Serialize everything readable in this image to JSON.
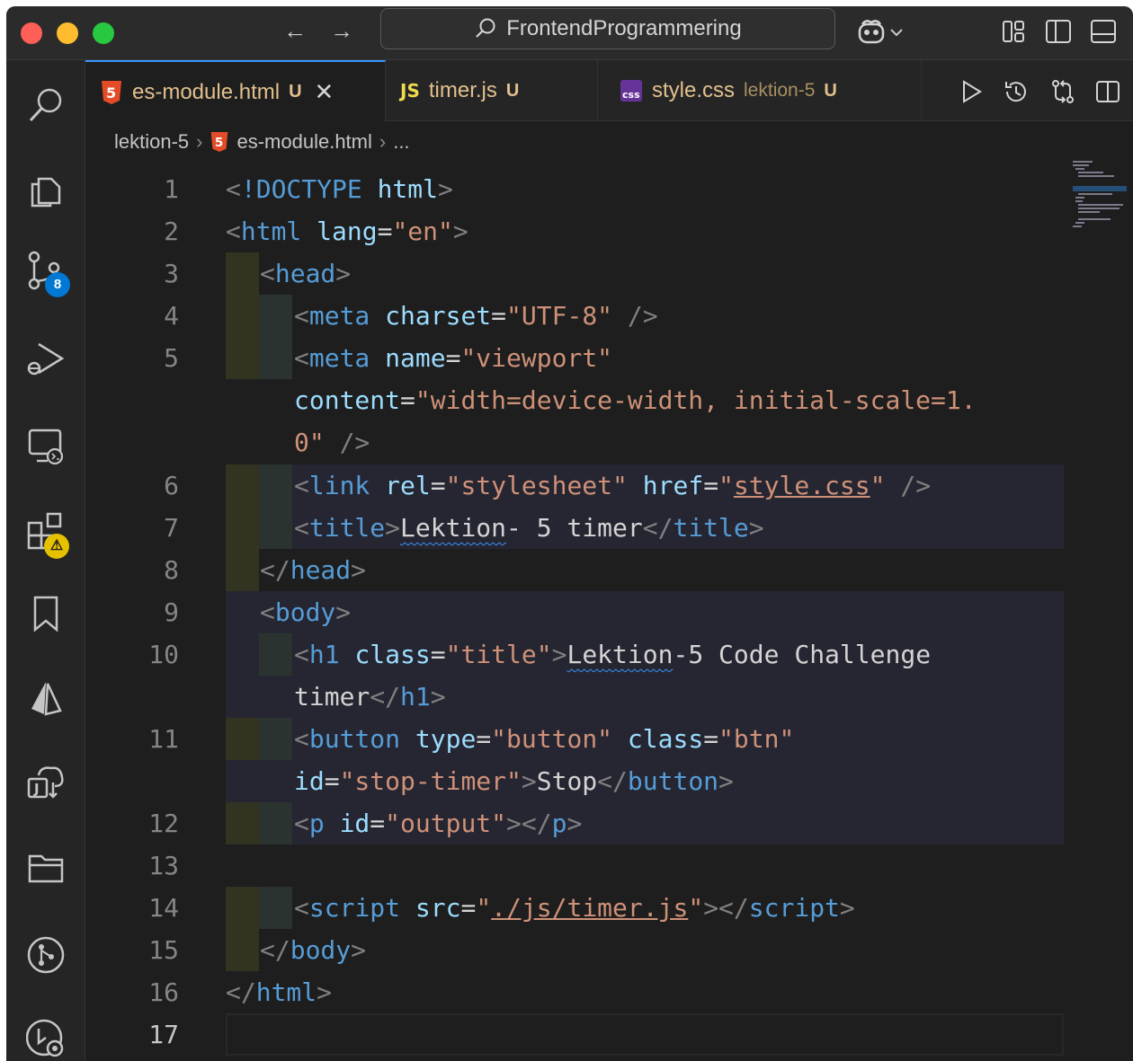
{
  "titlebar": {
    "search_text": "FrontendProgrammering",
    "back_icon": "arrow-left-icon",
    "forward_icon": "arrow-right-icon",
    "copilot_icon": "copilot-icon"
  },
  "activity_bar": {
    "items": [
      "search-icon",
      "explorer-icon",
      "source-control-icon",
      "run-debug-icon",
      "remote-explorer-icon",
      "extensions-icon",
      "bookmarks-icon",
      "azure-icon",
      "java-projects-icon",
      "folder-icon",
      "git-graph-icon",
      "timeline-icon"
    ],
    "source_control_badge": "8",
    "extensions_badge": "⚠"
  },
  "tabs": [
    {
      "label": "es-module.html",
      "status": "U",
      "active": true
    },
    {
      "label": "timer.js",
      "status": "U",
      "active": false
    },
    {
      "label": "style.css",
      "description": "lektion-5",
      "status": "U",
      "active": false
    }
  ],
  "breadcrumb": {
    "folder": "lektion-5",
    "file": "es-module.html",
    "more": "..."
  },
  "editor": {
    "line_numbers": [
      "1",
      "2",
      "3",
      "4",
      "5",
      "",
      "",
      "6",
      "7",
      "8",
      "9",
      "10",
      "",
      "11",
      "",
      "12",
      "13",
      "14",
      "15",
      "16",
      "17"
    ],
    "lines": {
      "l1": {
        "open": "<",
        "kw": "!DOCTYPE",
        "sp": " ",
        "tag": "html",
        "close": ">"
      },
      "l2": {
        "open": "<",
        "tag": "html",
        "sp": " ",
        "attr": "lang",
        "eq": "=",
        "val": "\"en\"",
        "close": ">"
      },
      "l3": {
        "open": "<",
        "tag": "head",
        "close": ">"
      },
      "l4": {
        "open": "<",
        "tag": "meta",
        "sp": " ",
        "attr": "charset",
        "eq": "=",
        "val": "\"UTF-8\"",
        "end": " />"
      },
      "l5": {
        "open": "<",
        "tag": "meta",
        "sp": " ",
        "attr": "name",
        "eq": "=",
        "val": "\"viewport\""
      },
      "l5b": {
        "attr": "content",
        "eq": "=",
        "val": "\"width=device-width, initial-scale=1."
      },
      "l5c": {
        "val": "0\"",
        "end": " />"
      },
      "l6": {
        "open": "<",
        "tag": "link",
        "attr1": "rel",
        "val1": "\"stylesheet\"",
        "attr2": "href",
        "q1": "\"",
        "link": "style.css",
        "q2": "\"",
        "end": " />"
      },
      "l7": {
        "open": "<",
        "tag": "title",
        "close": ">",
        "text1": "Lektion",
        "text2": "- 5 timer",
        "copen": "</",
        "ctag": "title",
        "cclose": ">"
      },
      "l8": {
        "open": "</",
        "tag": "head",
        "close": ">"
      },
      "l9": {
        "open": "<",
        "tag": "body",
        "close": ">"
      },
      "l10": {
        "open": "<",
        "tag": "h1",
        "attr": "class",
        "val": "\"title\"",
        "close": ">",
        "text1": "Lektion",
        "text2": "-5 Code Challenge"
      },
      "l10b": {
        "text": "timer",
        "copen": "</",
        "ctag": "h1",
        "cclose": ">"
      },
      "l11": {
        "open": "<",
        "tag": "button",
        "attr1": "type",
        "val1": "\"button\"",
        "attr2": "class",
        "val2": "\"btn\""
      },
      "l11b": {
        "attr": "id",
        "val": "\"stop-timer\"",
        "close": ">",
        "text": "Stop",
        "copen": "</",
        "ctag": "button",
        "cclose": ">"
      },
      "l12": {
        "open": "<",
        "tag": "p",
        "attr": "id",
        "val": "\"output\"",
        "close": ">",
        "copen": "</",
        "ctag": "p",
        "cclose": ">"
      },
      "l14": {
        "open": "<",
        "tag": "script",
        "attr": "src",
        "q1": "\"",
        "link": "./js/timer.js",
        "q2": "\"",
        "close": ">",
        "copen": "</",
        "ctag": "script",
        "cclose": ">"
      },
      "l15": {
        "open": "</",
        "tag": "body",
        "close": ">"
      },
      "l16": {
        "open": "</",
        "tag": "html",
        "close": ">"
      }
    }
  },
  "colors": {
    "tag": "#569cd6",
    "attr": "#9cdcfe",
    "string": "#ce9178",
    "punct": "#808080",
    "text": "#d4d4d4",
    "accent": "#3794ff",
    "modified": "#e2c08d"
  }
}
